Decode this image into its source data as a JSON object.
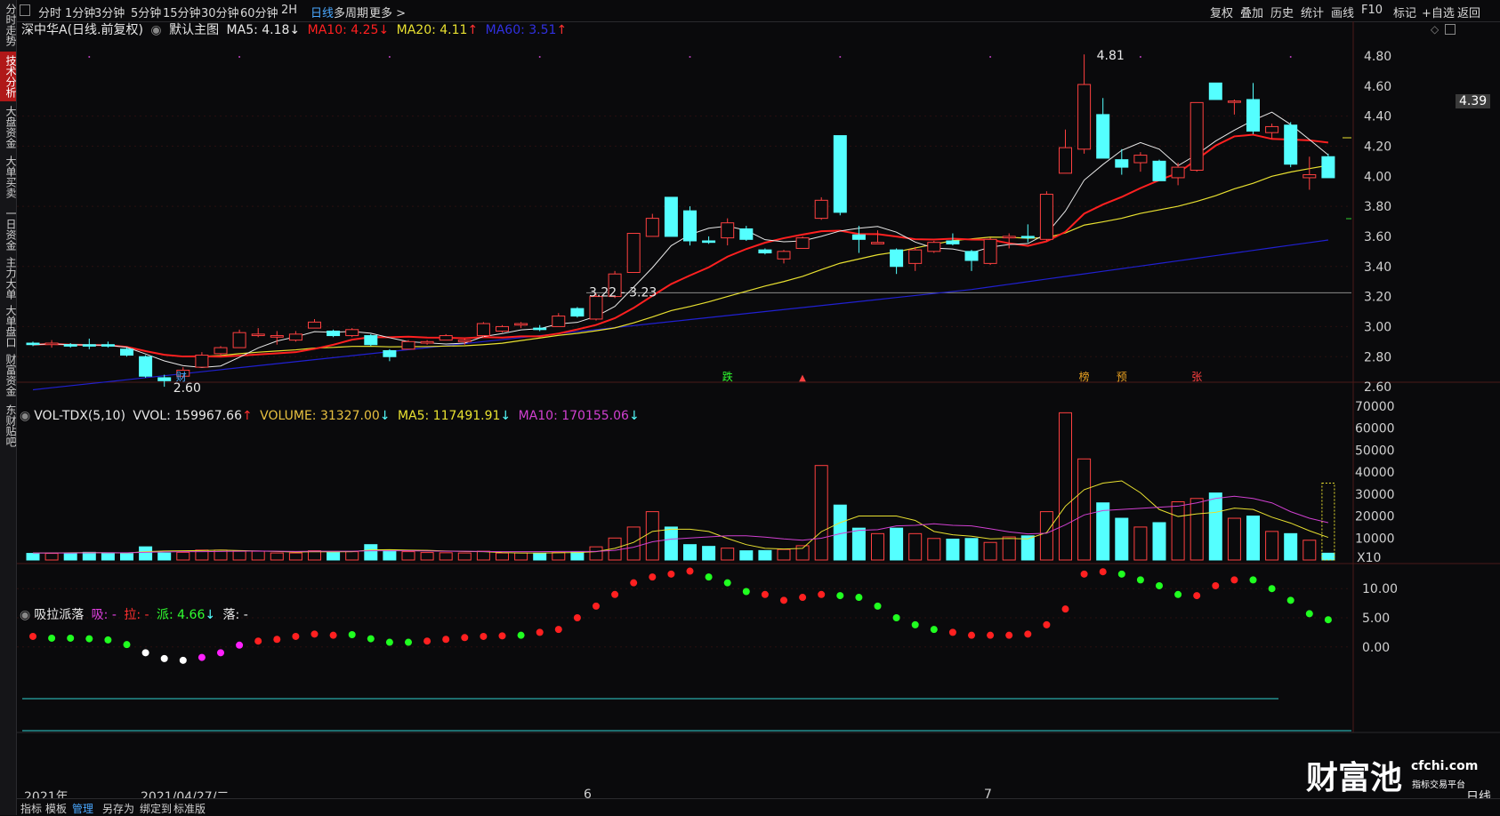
{
  "left_tabs": [
    {
      "label": "分时走势",
      "active": false
    },
    {
      "label": "技术分析",
      "active": true
    },
    {
      "label": "大盘资金",
      "active": false
    },
    {
      "label": "大单买卖",
      "active": false
    },
    {
      "label": "一日资金",
      "active": false
    },
    {
      "label": "主力大单",
      "active": false
    },
    {
      "label": "大单盘口",
      "active": false
    },
    {
      "label": "财富资金",
      "active": false
    },
    {
      "label": "东财贴吧",
      "active": false
    }
  ],
  "period_tabs": [
    "分时",
    "1分钟",
    "3分钟",
    "5分钟",
    "15分钟",
    "30分钟",
    "60分钟",
    "2H",
    "日线",
    "多周期",
    "更多 >"
  ],
  "active_period": "日线",
  "right_tools": [
    "复权",
    "叠加",
    "历史",
    "统计",
    "画线",
    "F10",
    "标记",
    "+自选",
    "返回"
  ],
  "main_legend": {
    "title": "深中华A(日线.前复权)",
    "indicator": "默认主图",
    "ma5": "MA5: 4.18↓",
    "ma10": "MA10: 4.25",
    "ma10_arrow": "↓",
    "ma20": "MA20: 4.11",
    "ma20_arrow": "↑",
    "ma60": "MA60: 3.51",
    "ma60_arrow": "↑"
  },
  "vol_legend": {
    "name": "VOL-TDX(5,10)",
    "vvol": "VVOL: 159967.66",
    "vvol_arrow": "↑",
    "volume": "VOLUME: 31327.00",
    "volume_arrow": "↓",
    "ma5": "MA5: 117491.91",
    "ma5_arrow": "↓",
    "ma10": "MA10: 170155.06",
    "ma10_arrow": "↓"
  },
  "ind_legend": {
    "name": "吸拉派落",
    "xi": "吸: -",
    "la": "拉: -",
    "pai": "派: 4.66",
    "pai_arrow": "↓",
    "luo": "落: -"
  },
  "price_axis": [
    "4.80",
    "4.60",
    "4.40",
    "4.20",
    "4.00",
    "3.80",
    "3.60",
    "3.40",
    "3.20",
    "3.00",
    "2.80",
    "2.60"
  ],
  "current_price": "4.39",
  "vol_axis": [
    "70000",
    "60000",
    "50000",
    "40000",
    "30000",
    "20000",
    "10000"
  ],
  "vol_unit": "X10",
  "ind_axis": [
    "10.00",
    "5.00",
    "0.00"
  ],
  "annotations": {
    "high": "4.81",
    "low": "2.60",
    "range": "3.22 - 3.23",
    "cai": "财",
    "die": "跌",
    "bang": "榜",
    "yu": "预",
    "zhang": "张"
  },
  "dates": {
    "year": "2021年",
    "cursor": "2021/04/27/二",
    "m6": "6",
    "m7": "7",
    "period": "日线"
  },
  "bottom_tabs": [
    "指标",
    "模板",
    "管理",
    "另存为",
    "绑定到",
    "标准版"
  ],
  "active_bottom": "管理",
  "watermark": {
    "brand": "财富池",
    "site": "cfchi.com",
    "sub": "指标交易平台"
  },
  "colors": {
    "up": "#ff4040",
    "down": "#54ffff",
    "ma5": "#e8e8e8",
    "ma10": "#ff2020",
    "ma20": "#e8e030",
    "ma60": "#2020d0",
    "vol_ma10": "#d040d0"
  },
  "chart_data": {
    "type": "candlestick",
    "candles": [
      [
        2.89,
        2.9,
        2.87,
        2.88
      ],
      [
        2.88,
        2.91,
        2.86,
        2.89
      ],
      [
        2.88,
        2.89,
        2.86,
        2.87
      ],
      [
        2.88,
        2.92,
        2.85,
        2.87
      ],
      [
        2.88,
        2.9,
        2.86,
        2.87
      ],
      [
        2.85,
        2.86,
        2.8,
        2.81
      ],
      [
        2.8,
        2.81,
        2.66,
        2.67
      ],
      [
        2.66,
        2.68,
        2.6,
        2.64
      ],
      [
        2.67,
        2.73,
        2.66,
        2.71
      ],
      [
        2.73,
        2.83,
        2.73,
        2.81
      ],
      [
        2.82,
        2.87,
        2.8,
        2.86
      ],
      [
        2.86,
        2.98,
        2.86,
        2.96
      ],
      [
        2.94,
        2.99,
        2.93,
        2.95
      ],
      [
        2.93,
        2.97,
        2.88,
        2.94
      ],
      [
        2.91,
        2.97,
        2.9,
        2.95
      ],
      [
        2.99,
        3.05,
        2.99,
        3.03
      ],
      [
        2.97,
        2.98,
        2.93,
        2.94
      ],
      [
        2.94,
        2.99,
        2.93,
        2.98
      ],
      [
        2.94,
        2.95,
        2.87,
        2.88
      ],
      [
        2.84,
        2.85,
        2.77,
        2.8
      ],
      [
        2.85,
        2.91,
        2.85,
        2.9
      ],
      [
        2.89,
        2.91,
        2.88,
        2.9
      ],
      [
        2.91,
        2.95,
        2.91,
        2.94
      ],
      [
        2.9,
        2.92,
        2.88,
        2.91
      ],
      [
        2.94,
        3.03,
        2.93,
        3.02
      ],
      [
        2.97,
        3.01,
        2.96,
        3.0
      ],
      [
        3.01,
        3.03,
        2.99,
        3.02
      ],
      [
        2.99,
        3.01,
        2.97,
        2.98
      ],
      [
        3.0,
        3.09,
        3.0,
        3.07
      ],
      [
        3.12,
        3.13,
        3.06,
        3.07
      ],
      [
        3.05,
        3.22,
        3.04,
        3.2
      ],
      [
        3.2,
        3.37,
        3.19,
        3.35
      ],
      [
        3.36,
        3.62,
        3.36,
        3.62
      ],
      [
        3.6,
        3.75,
        3.6,
        3.72
      ],
      [
        3.8,
        3.86,
        3.8
      ],
      [
        3.77,
        3.8,
        3.54,
        3.57
      ],
      [
        3.57,
        3.6,
        3.55,
        3.56
      ],
      [
        3.59,
        3.72,
        3.54,
        3.69
      ],
      [
        3.65,
        3.67,
        3.57,
        3.58
      ],
      [
        3.51,
        3.52,
        3.48,
        3.49
      ],
      [
        3.45,
        3.51,
        3.42,
        3.5
      ],
      [
        3.52,
        3.6,
        3.52,
        3.59
      ],
      [
        3.72,
        3.86,
        3.71,
        3.84
      ],
      [
        4.27,
        4.27,
        3.74,
        3.76
      ],
      [
        3.61,
        3.67,
        3.49,
        3.58
      ],
      [
        3.55,
        3.64,
        3.55,
        3.56
      ],
      [
        3.51,
        3.52,
        3.35,
        3.4
      ],
      [
        3.42,
        3.53,
        3.37,
        3.51
      ],
      [
        3.5,
        3.57,
        3.49,
        3.56
      ],
      [
        3.57,
        3.62,
        3.54,
        3.55
      ],
      [
        3.5,
        3.51,
        3.37,
        3.44
      ],
      [
        3.42,
        3.59,
        3.41,
        3.58
      ],
      [
        3.59,
        3.62,
        3.52,
        3.6
      ],
      [
        3.6,
        3.68,
        3.56,
        3.59
      ],
      [
        3.58,
        3.9,
        3.57,
        3.88
      ],
      [
        4.02,
        4.31,
        4.02,
        4.19
      ],
      [
        4.18,
        4.81,
        4.15,
        4.61
      ],
      [
        4.41,
        4.52,
        4.12,
        4.12
      ],
      [
        4.11,
        4.18,
        4.01,
        4.06
      ],
      [
        4.09,
        4.16,
        4.03,
        4.14
      ],
      [
        4.1,
        4.11,
        3.97,
        3.97
      ],
      [
        3.99,
        4.09,
        3.94,
        4.06
      ],
      [
        4.04,
        4.49,
        4.03,
        4.49
      ],
      [
        4.62,
        4.62,
        4.51,
        4.51
      ],
      [
        4.5,
        4.51,
        4.41,
        4.5
      ],
      [
        4.51,
        4.62,
        4.28,
        4.3
      ],
      [
        4.29,
        4.35,
        4.25,
        4.33
      ],
      [
        4.34,
        4.36,
        4.06,
        4.08
      ],
      [
        3.99,
        4.13,
        3.91,
        4.01
      ],
      [
        4.13,
        4.15,
        3.99,
        3.99
      ]
    ],
    "volume": [
      3000,
      3000,
      3200,
      3500,
      3100,
      2900,
      6000,
      3200,
      3500,
      4500,
      4500,
      4000,
      4000,
      3200,
      3200,
      4200,
      3400,
      3800,
      7000,
      4300,
      3800,
      3400,
      3300,
      3200,
      4000,
      3200,
      3200,
      3100,
      3400,
      3600,
      6000,
      10000,
      15000,
      22000,
      15000,
      7000,
      6200,
      5400,
      4200,
      4300,
      4800,
      6500,
      43000,
      25000,
      14500,
      12000,
      14500,
      12000,
      9800,
      9500,
      9800,
      8000,
      10500,
      11000,
      22000,
      67000,
      46000,
      26000,
      19000,
      15000,
      17000,
      26500,
      28000,
      30500,
      19000,
      20000,
      13000,
      12000,
      9000,
      3100
    ],
    "vol_ma5": [
      3200,
      3200,
      3300,
      3400,
      3300,
      3200,
      3800,
      4100,
      4200,
      4300,
      4500,
      4300,
      4100,
      3900,
      3600,
      3800,
      3700,
      3800,
      4600,
      4700,
      4500,
      4400,
      4100,
      3900,
      3800,
      3400,
      3200,
      3200,
      3300,
      3400,
      3800,
      5300,
      8000,
      13000,
      14000,
      14000,
      13000,
      9800,
      7000,
      5300,
      5000,
      5300,
      12900,
      17000,
      20000,
      20000,
      20000,
      18000,
      13000,
      11500,
      10800,
      9600,
      9800,
      9600,
      12500,
      24500,
      32000,
      35000,
      36000,
      30600,
      23000,
      19800,
      21000,
      21700,
      23600,
      23000,
      19500,
      16800,
      13300,
      10300
    ],
    "vol_ma10": [
      3200,
      3200,
      3200,
      3300,
      3300,
      3300,
      3500,
      3700,
      3800,
      3800,
      3900,
      4000,
      4100,
      4000,
      3900,
      4000,
      4000,
      4000,
      4200,
      4200,
      4200,
      4100,
      4000,
      4000,
      3900,
      3800,
      3800,
      3800,
      3900,
      3900,
      3900,
      4400,
      5800,
      8300,
      9500,
      10000,
      10500,
      11000,
      11000,
      10400,
      9600,
      9000,
      9900,
      12000,
      13500,
      13800,
      15500,
      15800,
      16500,
      15800,
      15500,
      14200,
      12800,
      11900,
      12200,
      16000,
      20500,
      22500,
      23000,
      23500,
      24000,
      24500,
      26000,
      28000,
      29000,
      28000,
      26000,
      22000,
      19000,
      17000
    ],
    "xlpl": [
      1.8,
      1.5,
      1.5,
      1.4,
      1.2,
      0.4,
      -1,
      -2,
      -2.3,
      -1.8,
      -1,
      0.3,
      1,
      1.3,
      1.8,
      2.2,
      2,
      2.1,
      1.4,
      0.8,
      0.8,
      1,
      1.3,
      1.6,
      1.8,
      1.9,
      2,
      2.5,
      3,
      5,
      7,
      9,
      11,
      12,
      12.5,
      13,
      12,
      11,
      9.5,
      9,
      8,
      8.5,
      9,
      8.8,
      8.5,
      7,
      5,
      3.8,
      3,
      2.5,
      2,
      2,
      2,
      2.2,
      3.8,
      6.5,
      12.5,
      12.9,
      12.5,
      11.5,
      10.5,
      9,
      8.8,
      10.5,
      11.5,
      11.5,
      10,
      8,
      5.7,
      4.66
    ],
    "xlpl_color": [
      "r",
      "g",
      "g",
      "g",
      "g",
      "g",
      "w",
      "w",
      "w",
      "m",
      "m",
      "m",
      "r",
      "r",
      "r",
      "r",
      "r",
      "g",
      "g",
      "g",
      "g",
      "r",
      "r",
      "r",
      "r",
      "r",
      "g",
      "r",
      "r",
      "r",
      "r",
      "r",
      "r",
      "r",
      "r",
      "r",
      "g",
      "g",
      "g",
      "r",
      "r",
      "r",
      "r",
      "g",
      "g",
      "g",
      "g",
      "g",
      "g",
      "r",
      "r",
      "r",
      "r",
      "r",
      "r",
      "r",
      "r",
      "r",
      "g",
      "g",
      "g",
      "g",
      "r",
      "r",
      "r",
      "g",
      "g",
      "g",
      "g",
      "g"
    ]
  }
}
